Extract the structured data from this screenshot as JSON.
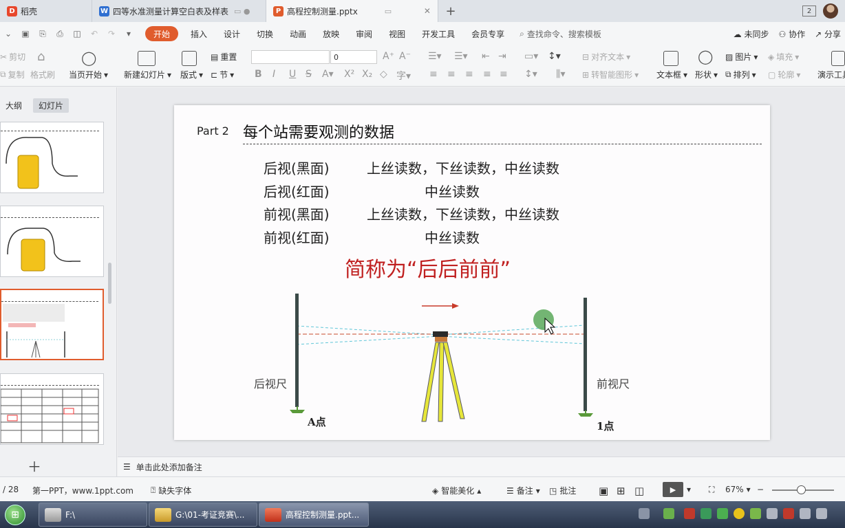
{
  "tabs": [
    {
      "label": "稻壳",
      "icon_color": "#e8472c",
      "icon": "D"
    },
    {
      "label": "四等水准测量计算空白表及样表",
      "icon_color": "#2f6fd1",
      "icon": "W"
    },
    {
      "label": "高程控制测量.pptx",
      "icon_color": "#e05c2d",
      "icon": "P"
    }
  ],
  "tabbar": {
    "window_count": "2"
  },
  "menu": {
    "items": [
      "开始",
      "插入",
      "设计",
      "切换",
      "动画",
      "放映",
      "审阅",
      "视图",
      "开发工具",
      "会员专享"
    ],
    "search": "查找命令、搜索模板",
    "right": [
      "未同步",
      "协作",
      "分享"
    ]
  },
  "ribbon": {
    "cut": "剪切",
    "copy": "复制",
    "format_painter": "格式刷",
    "play_from_current": "当页开始",
    "new_slide": "新建幻灯片",
    "layout": "版式",
    "reset": "重置",
    "section": "节",
    "font_size": "0",
    "align_text": "对齐文本",
    "smart_shape": "转智能图形",
    "textbox": "文本框",
    "shape": "形状",
    "picture": "图片",
    "fill": "填充",
    "arrange": "排列",
    "outline": "轮廓",
    "presenter": "演示工具"
  },
  "left_panel": {
    "outline_tab": "大纲",
    "slides_tab": "幻灯片",
    "slide_count": "28"
  },
  "slide": {
    "part": "Part 2",
    "title": "每个站需要观测的数据",
    "rows": [
      {
        "label": "后视(黑面)",
        "value": "上丝读数，下丝读数，中丝读数"
      },
      {
        "label": "后视(红面)",
        "value": "中丝读数"
      },
      {
        "label": "前视(黑面)",
        "value": "上丝读数，下丝读数，中丝读数"
      },
      {
        "label": "前视(红面)",
        "value": "中丝读数"
      }
    ],
    "abbr": "简称为“后后前前”",
    "back_rod_label": "后视尺",
    "front_rod_label": "前视尺",
    "point_a": "A点",
    "point_1": "1点"
  },
  "notes": {
    "placeholder": "单击此处添加备注"
  },
  "status": {
    "page": "/ 28",
    "template": "第一PPT，www.1ppt.com",
    "missing_font": "缺失字体",
    "beautify": "智能美化",
    "notes": "备注",
    "comment": "批注",
    "zoom": "67%"
  },
  "taskbar": {
    "items": [
      "F:\\",
      "G:\\01-考证竞赛\\...",
      "高程控制测量.ppt..."
    ]
  },
  "colors": {
    "accent": "#e05c2d",
    "title_red": "#c02020"
  }
}
